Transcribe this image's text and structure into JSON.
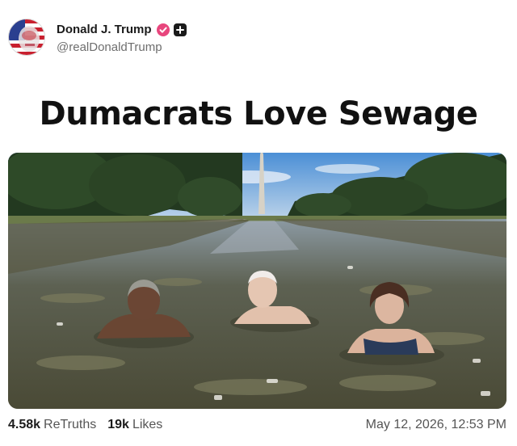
{
  "author": {
    "display_name": "Donald J. Trump",
    "handle": "@realDonaldTrump"
  },
  "icons": {
    "verified": "verified-badge-icon",
    "plus": "plus-badge-icon"
  },
  "colors": {
    "verified_badge": "#e8467d",
    "plus_badge": "#1b1b1b"
  },
  "post": {
    "headline": "Dumacrats Love Sewage"
  },
  "stats": {
    "retruths_count": "4.58k",
    "retruths_label": "ReTruths",
    "likes_count": "19k",
    "likes_label": "Likes",
    "timestamp": "May 12, 2026, 12:53 PM"
  }
}
